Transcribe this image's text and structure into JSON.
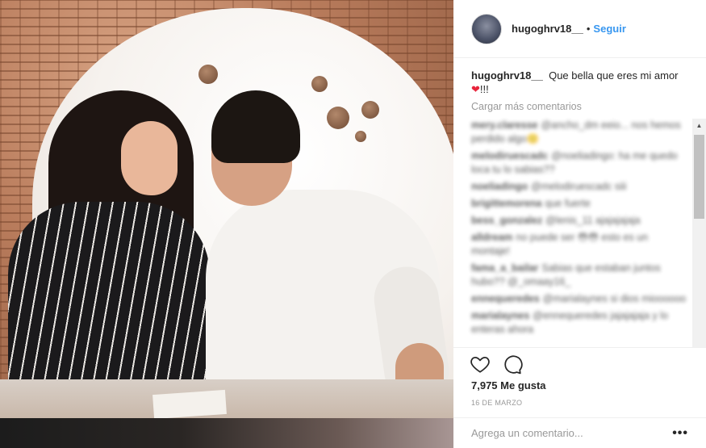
{
  "post": {
    "username": "hugoghrv18__",
    "follow_label": "Seguir",
    "separator": "•"
  },
  "caption": {
    "username": "hugoghrv18__",
    "text": "Que bella que eres mi amor",
    "heart": "❤",
    "suffix": "!!!"
  },
  "load_more_label": "Cargar más comentarios",
  "comments": [
    {
      "user": "mery.claresse",
      "text": "@ancho_dm eeio... nos hemos perdido algo🙁"
    },
    {
      "user": "melodiruescadc",
      "text": "@noeliadingo: ha me quedo loca tu lo sabias??"
    },
    {
      "user": "noeliadingo",
      "text": "@melodiruescadc siii"
    },
    {
      "user": "brigittemorena",
      "text": "que fuerte"
    },
    {
      "user": "bess_gonzalez",
      "text": "@lenis_11 ajajajajaja"
    },
    {
      "user": "alldream",
      "text": "no puede ser 😳😳 esto es un montaje!"
    },
    {
      "user": "fama_a_bailar",
      "text": "Sabias que estaban juntos hubo?? @_omaay16_"
    },
    {
      "user": "ennequeredes",
      "text": "@marialaynes si dios mioooooo"
    },
    {
      "user": "marialaynes",
      "text": "@ennequeredes jajajajaja y lo enteras ahora"
    }
  ],
  "likes": {
    "count": "7,975",
    "label": "Me gusta"
  },
  "date": "16 DE MARZO",
  "add_comment": {
    "placeholder": "Agrega un comentario...",
    "more_label": "•••"
  },
  "icons": {
    "like": "heart-outline-icon",
    "comment": "speech-bubble-icon"
  }
}
